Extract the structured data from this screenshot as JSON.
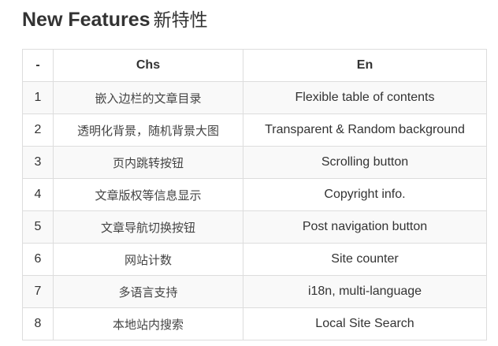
{
  "heading": {
    "title": "New Features",
    "title_cn": "新特性"
  },
  "table": {
    "headers": [
      "-",
      "Chs",
      "En"
    ],
    "rows": [
      {
        "num": "1",
        "chs": "嵌入边栏的文章目录",
        "en": "Flexible table of contents"
      },
      {
        "num": "2",
        "chs": "透明化背景，随机背景大图",
        "en": "Transparent & Random background"
      },
      {
        "num": "3",
        "chs": "页内跳转按钮",
        "en": "Scrolling button"
      },
      {
        "num": "4",
        "chs": "文章版权等信息显示",
        "en": "Copyright info."
      },
      {
        "num": "5",
        "chs": "文章导航切换按钮",
        "en": "Post navigation button"
      },
      {
        "num": "6",
        "chs": "网站计数",
        "en": "Site counter"
      },
      {
        "num": "7",
        "chs": "多语言支持",
        "en": "i18n, multi-language"
      },
      {
        "num": "8",
        "chs": "本地站内搜索",
        "en": "Local Site Search"
      }
    ]
  },
  "colors": {
    "text": "#333333",
    "border": "#dddddd",
    "stripe": "#f9f9f9"
  }
}
